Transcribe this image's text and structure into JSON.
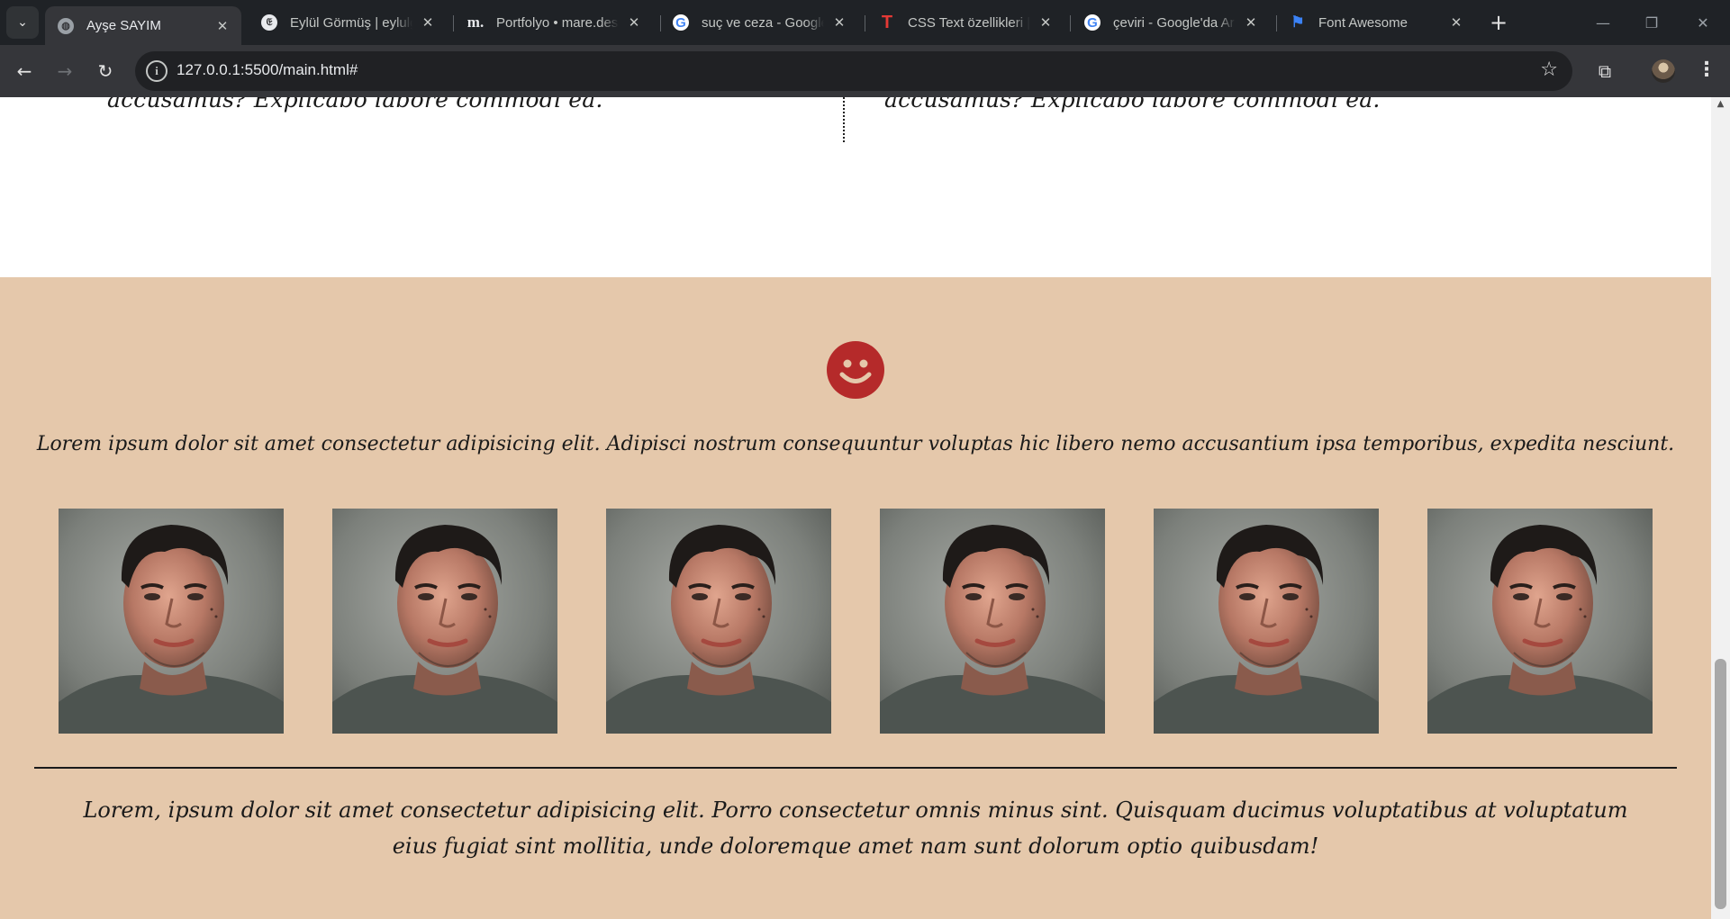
{
  "browser": {
    "tabs": [
      {
        "title": "Ayşe SAYIM",
        "favicon": "globe-icon",
        "active": true
      },
      {
        "title": "Eylül Görmüş | eylulg",
        "favicon": "site-icon"
      },
      {
        "title": "Portfolyo • mare.desi",
        "favicon": "m-icon"
      },
      {
        "title": "suç ve ceza - Google",
        "favicon": "google-icon"
      },
      {
        "title": "CSS Text özellikleri |",
        "favicon": "t-icon"
      },
      {
        "title": "çeviri - Google'da Ar",
        "favicon": "google-icon"
      },
      {
        "title": "Font Awesome",
        "favicon": "flag-icon"
      }
    ],
    "url": "127.0.0.1:5500/main.html#"
  },
  "page": {
    "left_column_tail": "accusamus? Explicabo labore commodi ea.",
    "right_column_tail": "accusamus? Explicabo labore commodi ea.",
    "smiley_icon": "smile-icon",
    "accent_color": "#b52a2a",
    "section_background": "#e5c8ab",
    "intro_text": "Lorem ipsum dolor sit amet consectetur adipisicing elit. Adipisci nostrum consequuntur voluptas hic libero nemo accusantium ipsa temporibus, expedita nesciunt.",
    "gallery_count": 6,
    "footer_text": "Lorem, ipsum dolor sit amet consectetur adipisicing elit. Porro consectetur omnis minus sint. Quisquam ducimus voluptatibus at voluptatum eius fugiat sint mollitia, unde doloremque amet nam sunt dolorum optio quibusdam!"
  }
}
